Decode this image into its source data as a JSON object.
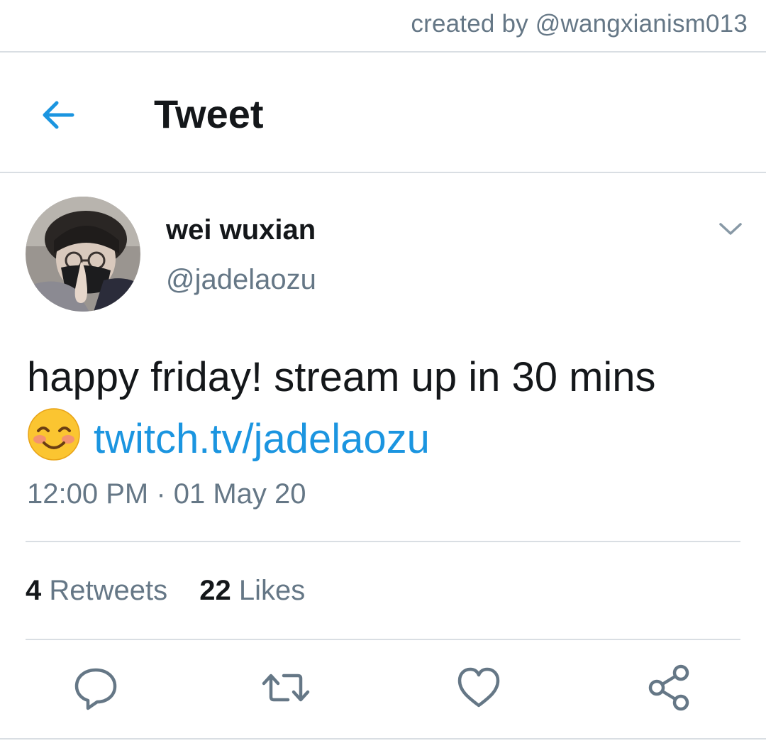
{
  "watermark": "created by @wangxianism013",
  "header": {
    "title": "Tweet",
    "back_icon": "arrow-left-icon"
  },
  "tweet": {
    "display_name": "wei wuxian",
    "handle": "@jadelaozu",
    "text_main": "happy friday! stream up in 30 mins",
    "emoji": "smiling-face-with-blush",
    "link": "twitch.tv/jadelaozu",
    "timestamp": "12:00 PM · 01 May 20",
    "retweets_count": "4",
    "retweets_label": "Retweets",
    "likes_count": "22",
    "likes_label": "Likes"
  },
  "actions": [
    "reply-icon",
    "retweet-icon",
    "like-icon",
    "share-icon"
  ],
  "colors": {
    "accent": "#1b95e0",
    "secondary_text": "#657786",
    "primary_text": "#14171a",
    "divider": "#d9dee3"
  }
}
